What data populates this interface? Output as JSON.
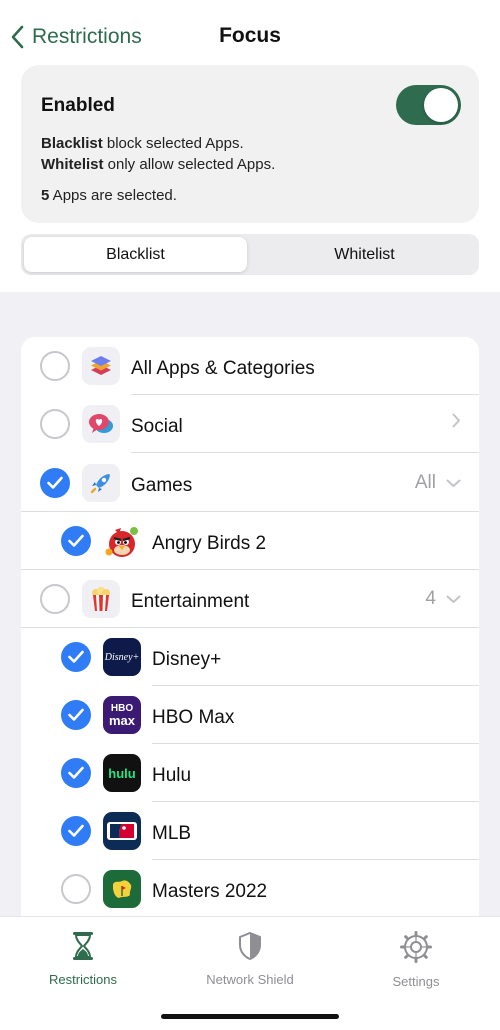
{
  "nav": {
    "back_label": "Restrictions",
    "title": "Focus"
  },
  "card": {
    "enabled_label": "Enabled",
    "toggle_on": true,
    "line1_bold": "Blacklist",
    "line1_rest": " block selected Apps.",
    "line2_bold": "Whitelist",
    "line2_rest": " only allow selected Apps.",
    "line3_bold": "5",
    "line3_rest": " Apps are selected."
  },
  "segment": {
    "active": "Blacklist",
    "inactive": "Whitelist"
  },
  "list": {
    "all_apps": {
      "label": "All Apps & Categories",
      "selected": false,
      "icon": "stack-icon"
    },
    "social": {
      "label": "Social",
      "selected": false,
      "icon": "chat-bubble-heart-icon"
    },
    "games": {
      "label": "Games",
      "selected": true,
      "count": "All",
      "icon": "rocket-icon"
    },
    "angry_birds": {
      "label": "Angry Birds 2",
      "selected": true,
      "icon": "angry-birds-icon"
    },
    "entertainment": {
      "label": "Entertainment",
      "selected": false,
      "count": "4",
      "icon": "popcorn-icon"
    },
    "disney": {
      "label": "Disney+",
      "selected": true,
      "icon": "disney-plus-icon",
      "icon_text": "Disney+"
    },
    "hbo": {
      "label": "HBO Max",
      "selected": true,
      "icon": "hbo-max-icon",
      "icon_text_top": "HBO",
      "icon_text_bottom": "max"
    },
    "hulu": {
      "label": "Hulu",
      "selected": true,
      "icon": "hulu-icon",
      "icon_text": "hulu"
    },
    "mlb": {
      "label": "MLB",
      "selected": true,
      "icon": "mlb-icon"
    },
    "masters": {
      "label": "Masters 2022",
      "selected": false,
      "icon": "masters-icon"
    }
  },
  "tabs": [
    {
      "label": "Restrictions",
      "icon": "hourglass-icon",
      "active": true
    },
    {
      "label": "Network Shield",
      "icon": "shield-icon",
      "active": false
    },
    {
      "label": "Settings",
      "icon": "gear-icon",
      "active": false
    }
  ],
  "colors": {
    "accent": "#2f6b4f",
    "check_blue": "#2f7cf6",
    "inactive_gray": "#8e8e93"
  }
}
